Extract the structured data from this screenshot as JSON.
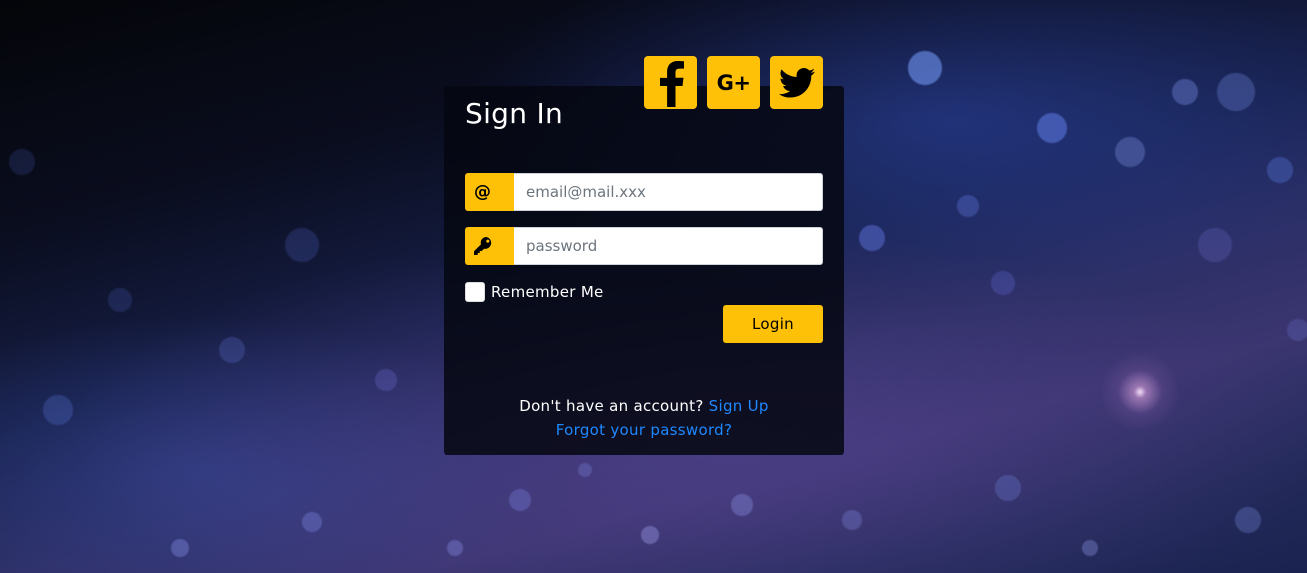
{
  "page": {
    "title": "Sign In"
  },
  "social": [
    {
      "name": "facebook",
      "icon": "facebook-icon"
    },
    {
      "name": "google-plus",
      "icon": "google-plus-icon",
      "label": "G+"
    },
    {
      "name": "twitter",
      "icon": "twitter-icon"
    }
  ],
  "form": {
    "email": {
      "value": "",
      "placeholder": "email@mail.xxx",
      "icon_text": "@",
      "icon": "at-icon"
    },
    "password": {
      "value": "",
      "placeholder": "password",
      "icon": "key-icon"
    },
    "remember_label": "Remember Me",
    "remember_checked": false,
    "login_label": "Login"
  },
  "footer": {
    "no_account_text": "Don't have an account?",
    "signup_link": "Sign Up",
    "forgot_link": "Forgot your password?"
  },
  "colors": {
    "accent": "#FFC107",
    "link": "#1e88ff",
    "panel_bg": "#05070f",
    "text": "#ffffff"
  }
}
